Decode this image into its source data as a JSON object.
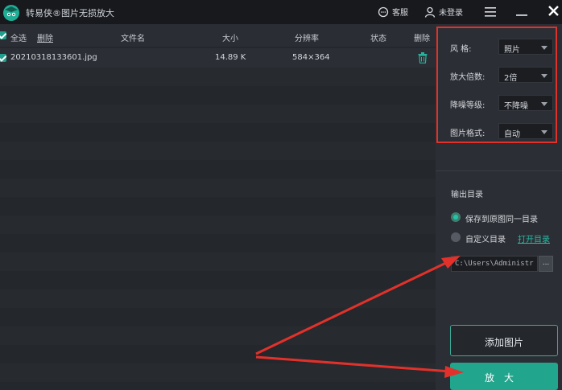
{
  "app": {
    "title": "转易侠®图片无损放大",
    "service_label": "客服",
    "login_label": "未登录"
  },
  "list": {
    "header": {
      "select_all": "全选",
      "delete_link": "删除",
      "col_filename": "文件名",
      "col_size": "大小",
      "col_resolution": "分辨率",
      "col_status": "状态",
      "col_delete": "删除"
    },
    "rows": [
      {
        "filename": "20210318133601.jpg",
        "size": "14.89 K",
        "resolution": "584×364",
        "status": "",
        "checked": true
      }
    ]
  },
  "settings": {
    "style_label": "风    格:",
    "style_value": "照片",
    "scale_label": "放大倍数:",
    "scale_value": "2倍",
    "denoise_label": "降噪等级:",
    "denoise_value": "不降噪",
    "format_label": "图片格式:",
    "format_value": "自动"
  },
  "output": {
    "label": "输出目录",
    "option_same": "保存到原图同一目录",
    "option_custom": "自定义目录",
    "open_dir": "打开目录",
    "path": "C:\\Users\\Administr",
    "browse": "..."
  },
  "buttons": {
    "add_image": "添加图片",
    "enlarge": "放大"
  },
  "colors": {
    "accent": "#21a58d",
    "annotation": "#e2312a",
    "background": "#24272c"
  }
}
